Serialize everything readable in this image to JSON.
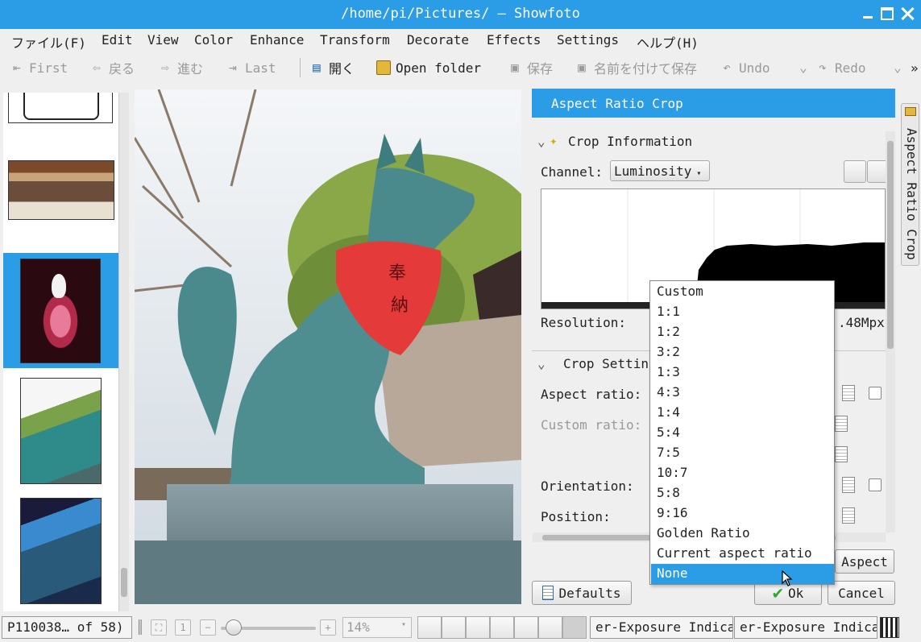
{
  "window": {
    "title": "/home/pi/Pictures/ — Showfoto"
  },
  "menu": [
    "ファイル(F)",
    "Edit",
    "View",
    "Color",
    "Enhance",
    "Transform",
    "Decorate",
    "Effects",
    "Settings",
    "ヘルプ(H)"
  ],
  "toolbar": {
    "first": "First",
    "back": "戻る",
    "forward": "進む",
    "last": "Last",
    "open": "開く",
    "open_folder": "Open folder",
    "save": "保存",
    "save_as": "名前を付けて保存",
    "undo": "Undo",
    "redo": "Redo",
    "more": "»"
  },
  "panel": {
    "title": "Aspect Ratio Crop",
    "crop_info_header": "Crop Information",
    "channel_label": "Channel:",
    "channel_value": "Luminosity",
    "resolution_label": "Resolution:",
    "resolution_value": ".48Mpx",
    "crop_settings_header": "Crop Settin",
    "aspect_ratio_label": "Aspect ratio:",
    "custom_ratio_label": "Custom ratio:",
    "orientation_label": "Orientation:",
    "position_label": "Position:",
    "aspect_button": "Aspect",
    "defaults_button": "Defaults",
    "ok_button": "Ok",
    "cancel_button": "Cancel"
  },
  "side_tab": {
    "label": "Aspect Ratio Crop"
  },
  "dropdown": {
    "options": [
      "Custom",
      "1:1",
      "1:2",
      "3:2",
      "1:3",
      "4:3",
      "1:4",
      "5:4",
      "7:5",
      "10:7",
      "5:8",
      "9:16",
      "Golden Ratio",
      "Current aspect ratio",
      "None"
    ],
    "highlighted": "None"
  },
  "status": {
    "file": "P110038… of 58)",
    "zoom": "14%",
    "indicator_1": "er-Exposure Indica",
    "indicator_2": "er-Exposure Indica"
  },
  "colors": {
    "accent": "#2b9ce6",
    "background": "#efefef"
  }
}
